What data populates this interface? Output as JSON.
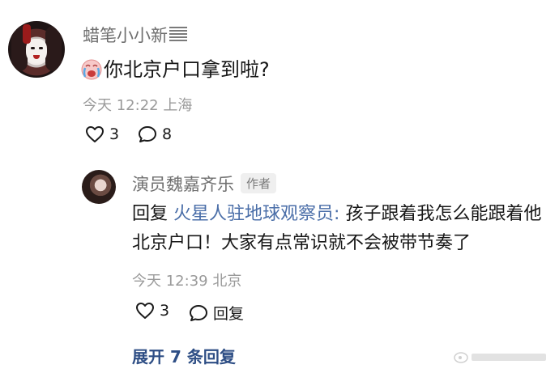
{
  "comment": {
    "username": "蜡笔小小新",
    "text": "你北京户口拿到啦?",
    "time": "今天 12:22",
    "location": "上海",
    "like_count": "3",
    "reply_count": "8",
    "emoji_icon": "crying-face-emoji"
  },
  "reply": {
    "username": "演员魏嘉齐乐",
    "badge": "作者",
    "prefix": "回复",
    "mention": "火星人驻地球观察员:",
    "text": "孩子跟着我怎么能跟着他北京户口！大家有点常识就不会被带节奏了",
    "time": "今天 12:39",
    "location": "北京",
    "like_count": "3",
    "reply_label": "回复"
  },
  "expand_label": "展开 7 条回复",
  "icons": {
    "like": "heart-icon",
    "comment": "comment-bubble-icon"
  },
  "colors": {
    "link": "#2e4e85",
    "mention": "#4a6ea8",
    "meta": "#9a9a9a"
  }
}
